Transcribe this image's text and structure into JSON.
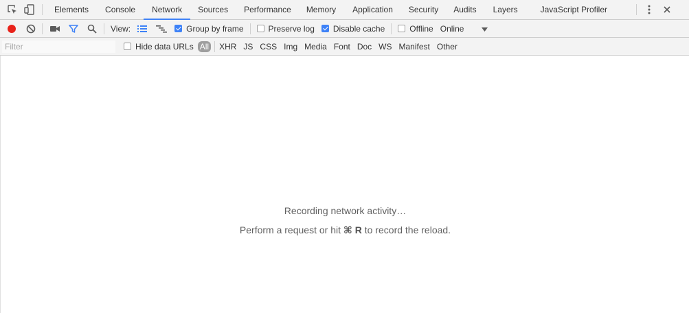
{
  "tabs": [
    {
      "label": "Elements"
    },
    {
      "label": "Console"
    },
    {
      "label": "Network",
      "selected": true
    },
    {
      "label": "Sources"
    },
    {
      "label": "Performance"
    },
    {
      "label": "Memory"
    },
    {
      "label": "Application"
    },
    {
      "label": "Security"
    },
    {
      "label": "Audits"
    },
    {
      "label": "Layers"
    },
    {
      "label": "JavaScript Profiler"
    }
  ],
  "toolbar": {
    "view_label": "View:",
    "group_by_frame": {
      "label": "Group by frame",
      "checked": true
    },
    "preserve_log": {
      "label": "Preserve log",
      "checked": false
    },
    "disable_cache": {
      "label": "Disable cache",
      "checked": true
    },
    "offline": {
      "label": "Offline",
      "checked": false
    },
    "throttling": {
      "value": "Online"
    }
  },
  "filterbar": {
    "placeholder": "Filter",
    "hide_data_urls": {
      "label": "Hide data URLs",
      "checked": false
    },
    "types": [
      "All",
      "XHR",
      "JS",
      "CSS",
      "Img",
      "Media",
      "Font",
      "Doc",
      "WS",
      "Manifest",
      "Other"
    ],
    "active_type": "All"
  },
  "empty_state": {
    "line1": "Recording network activity…",
    "line2_prefix": "Perform a request or hit ",
    "line2_shortcut": "⌘ R",
    "line2_suffix": " to record the reload."
  },
  "colors": {
    "record_active": "#e8221a",
    "accent": "#3e82f7",
    "toolbar_bg": "#f3f3f3"
  },
  "icons": [
    "inspect-element-icon",
    "device-toolbar-icon",
    "kebab-menu-icon",
    "close-icon",
    "record-icon",
    "clear-icon",
    "capture-screenshots-icon",
    "filter-icon",
    "search-icon",
    "large-rows-view-icon",
    "overview-view-icon",
    "throttling-dropdown-arrow-icon"
  ]
}
